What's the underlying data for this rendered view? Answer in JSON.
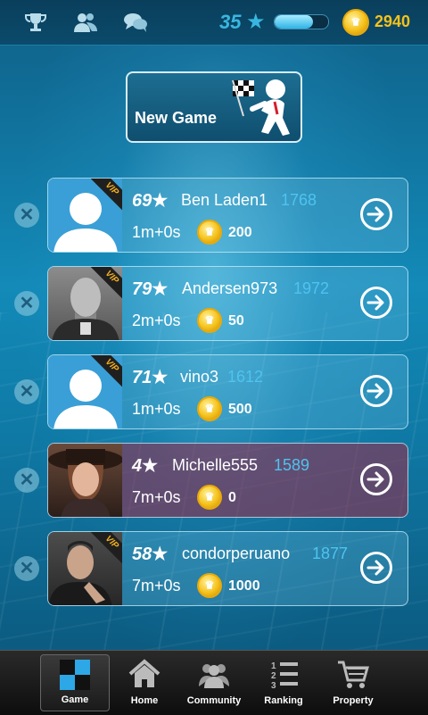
{
  "header": {
    "icons": [
      "trophy-icon",
      "friends-icon",
      "chat-icon"
    ],
    "level": "35",
    "xp_progress": 0.72,
    "coins": "2940"
  },
  "new_game": {
    "label": "New Game"
  },
  "games": [
    {
      "rank": "69",
      "name": "Ben Laden1",
      "rating": "1768",
      "time": "1m+0s",
      "bet": "200",
      "vip": "VIP",
      "avatar": "default",
      "color": "blue"
    },
    {
      "rank": "79",
      "name": "Andersen973",
      "rating": "1972",
      "time": "2m+0s",
      "bet": "50",
      "vip": "VIP",
      "avatar": "photo-old",
      "color": "blue"
    },
    {
      "rank": "71",
      "name": "vino3",
      "rating": "1612",
      "time": "1m+0s",
      "bet": "500",
      "vip": "VIP",
      "avatar": "default",
      "color": "blue"
    },
    {
      "rank": "4",
      "name": "Michelle555",
      "rating": "1589",
      "time": "7m+0s",
      "bet": "0",
      "vip": "",
      "avatar": "photo-woman",
      "color": "pink"
    },
    {
      "rank": "58",
      "name": "condorperuano",
      "rating": "1877",
      "time": "7m+0s",
      "bet": "1000",
      "vip": "VIP",
      "avatar": "photo-man",
      "color": "blue"
    }
  ],
  "nav": {
    "tabs": [
      {
        "label": "Game",
        "icon": "chessboard-icon",
        "active": true
      },
      {
        "label": "Home",
        "icon": "home-icon",
        "active": false
      },
      {
        "label": "Community",
        "icon": "community-icon",
        "active": false
      },
      {
        "label": "Ranking",
        "icon": "ranking-icon",
        "active": false
      },
      {
        "label": "Property",
        "icon": "cart-icon",
        "active": false
      }
    ]
  },
  "colors": {
    "accent": "#39b6e0",
    "gold": "#f5c21b",
    "female_row": "#a0284a"
  }
}
